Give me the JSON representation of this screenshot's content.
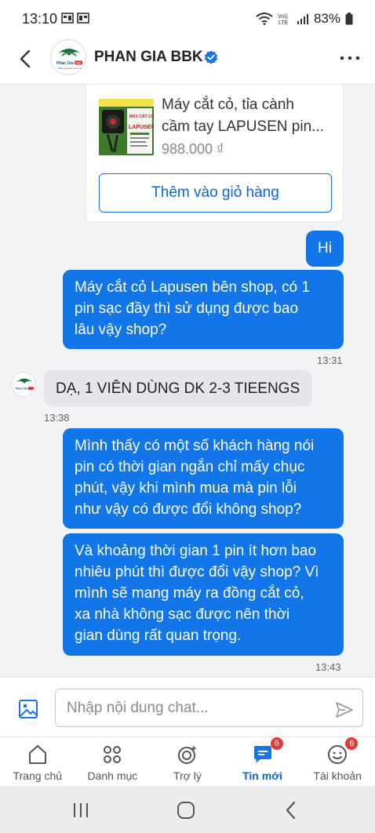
{
  "status_bar": {
    "time": "13:10",
    "battery": "83%"
  },
  "header": {
    "shop_name": "PHAN GIA BBK",
    "logo_text": "Phan Gia BBK",
    "logo_sub": "Không ngừng vươn xa"
  },
  "product": {
    "title_line1": "Máy cắt cỏ, tỉa cành",
    "title_line2": "cầm tay LAPUSEN pin...",
    "price": "988.000 ₫",
    "image_text_top": "MÁY CẮT CỎ",
    "image_text_brand": "LAPUSEN",
    "add_to_cart": "Thêm vào giỏ hàng"
  },
  "messages": [
    {
      "from": "me",
      "lines": [
        "Hi"
      ]
    },
    {
      "from": "me",
      "lines": [
        "Máy cắt cỏ Lapusen bên shop, có 1",
        "pin sạc đầy thì sử dụng được bao",
        "lâu vậy shop?"
      ],
      "time": "13:31"
    },
    {
      "from": "shop",
      "lines": [
        "DẠ, 1 VIÊN DÙNG DK 2-3 TIEENGS"
      ],
      "time": "13:38"
    },
    {
      "from": "me",
      "lines": [
        "Mình thấy có một số khách hàng nói",
        "pin có thời gian ngắn chỉ mấy chục",
        "phút, vậy khi mình mua mà pin lỗi",
        "như vậy có được đổi không shop?"
      ]
    },
    {
      "from": "me",
      "lines": [
        "Và khoảng thời gian 1 pin ít hơn bao",
        "nhiêu phút thì được đổi vậy shop? Vì",
        "mình sẽ mang máy ra đồng cắt cỏ,",
        "xa nhà không sạc được nên thời",
        "gian dùng rất quan trọng."
      ],
      "time": "13:43"
    }
  ],
  "composer": {
    "placeholder": "Nhập nội dung chat..."
  },
  "bottom_nav": {
    "items": [
      {
        "label": "Trang chủ",
        "icon": "home-icon"
      },
      {
        "label": "Danh mục",
        "icon": "grid-icon"
      },
      {
        "label": "Trợ lý",
        "icon": "assistant-icon"
      },
      {
        "label": "Tin mới",
        "icon": "chat-icon",
        "badge": "6",
        "active": true
      },
      {
        "label": "Tài khoản",
        "icon": "account-icon",
        "badge": "6"
      }
    ]
  },
  "colors": {
    "accent": "#1276e8",
    "badge": "#e53935"
  }
}
